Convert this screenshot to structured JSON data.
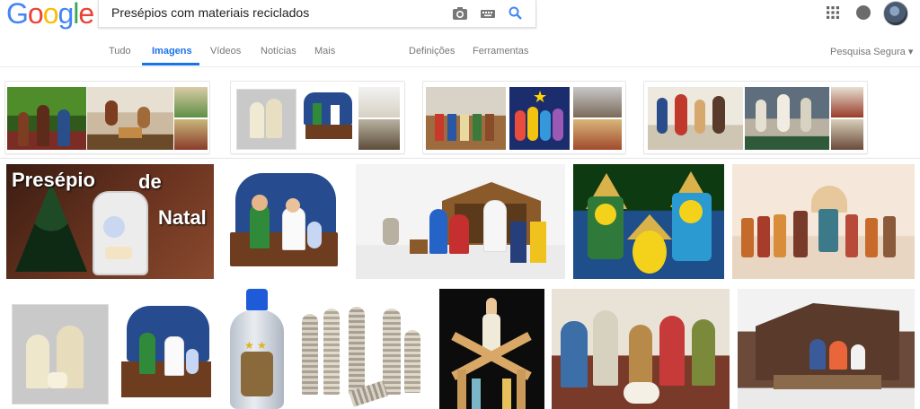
{
  "brand": {
    "letters": [
      "G",
      "o",
      "o",
      "g",
      "l",
      "e"
    ],
    "colors": [
      "#4285f4",
      "#ea4335",
      "#fbbc05",
      "#4285f4",
      "#34a853",
      "#ea4335"
    ]
  },
  "search": {
    "query": "Presépios com materiais reciclados"
  },
  "tabs": [
    "Tudo",
    "Imagens",
    "Vídeos",
    "Notícias",
    "Mais"
  ],
  "tools": [
    "Definições",
    "Ferramentas"
  ],
  "safe_search": "Pesquisa Segura ▾",
  "overlay": {
    "line1": "Presépio",
    "line2": "de",
    "line3": "Natal"
  },
  "icons": [
    "camera-icon",
    "keyboard-icon",
    "search-icon",
    "apps-icon",
    "notifications-icon",
    "avatar"
  ]
}
